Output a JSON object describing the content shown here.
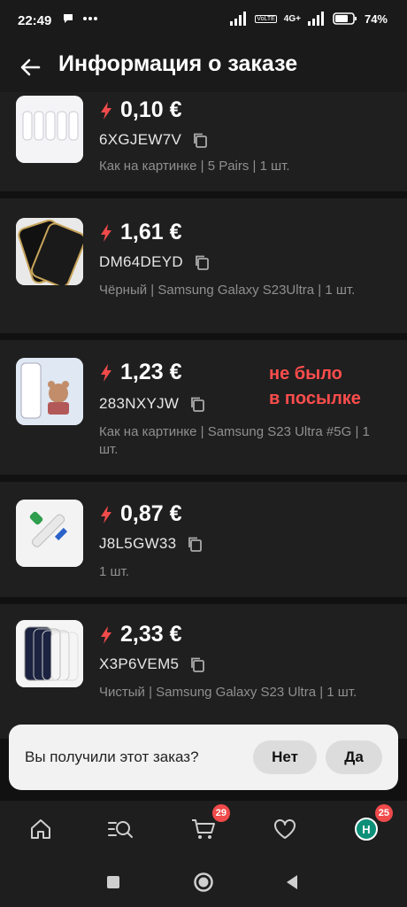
{
  "status": {
    "time": "22:49",
    "battery": "74%",
    "network": "4G+",
    "volte": "VoLTE"
  },
  "header": {
    "title": "Информация о заказе"
  },
  "items": [
    {
      "price": "0,10 €",
      "code": "6XGJEW7V",
      "desc": "Как на картинке | 5 Pairs | 1 шт."
    },
    {
      "price": "1,61 €",
      "code": "DM64DEYD",
      "desc": "Чёрный | Samsung Galaxy S23Ultra | 1 шт."
    },
    {
      "price": "1,23 €",
      "code": "283NXYJW",
      "desc": "Как на картинке | Samsung S23 Ultra #5G | 1 шт.",
      "note_line1": "не было",
      "note_line2": "в посылке"
    },
    {
      "price": "0,87 €",
      "code": "J8L5GW33",
      "desc": "1 шт."
    },
    {
      "price": "2,33 €",
      "code": "X3P6VEM5",
      "desc": "Чистый | Samsung Galaxy S23 Ultra | 1 шт."
    }
  ],
  "prompt": {
    "question": "Вы получили этот заказ?",
    "no_label": "Нет",
    "yes_label": "Да"
  },
  "nav": {
    "cart_badge": "29",
    "profile_badge": "25",
    "avatar_letter": "H"
  },
  "colors": {
    "accent": "#f04a4a",
    "note": "#ff4d4d",
    "avatar": "#0d8f78"
  },
  "icons": [
    "back-arrow-icon",
    "bolt-icon",
    "copy-icon",
    "home-icon",
    "search-list-icon",
    "cart-icon",
    "heart-icon"
  ]
}
